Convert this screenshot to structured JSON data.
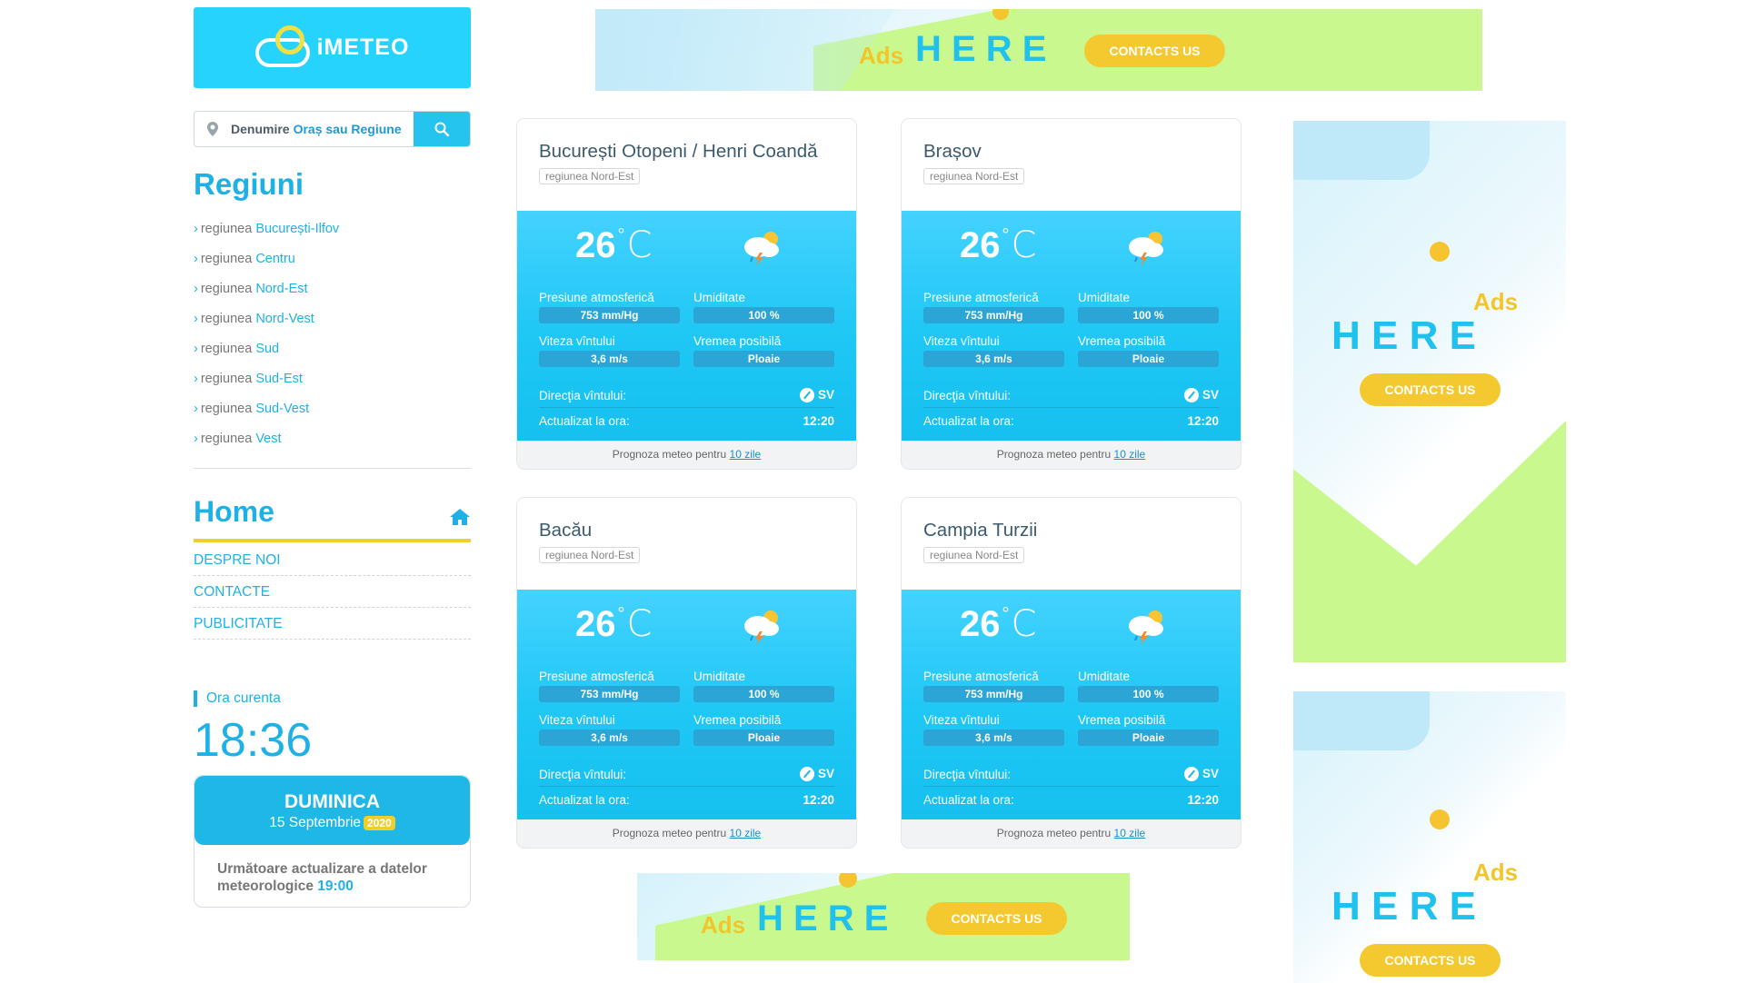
{
  "brand": {
    "logo_text": "iMETEO",
    "accent": "#25d3fd",
    "highlight": "#f1cf2b"
  },
  "search": {
    "placeholder_a": "Denumire",
    "placeholder_b": "Oraș sau Regiune"
  },
  "sidebar": {
    "regions_title": "Regiuni",
    "region_prefix": "regiunea",
    "regions": [
      "București-Ilfov",
      "Centru",
      "Nord-Est",
      "Nord-Vest",
      "Sud",
      "Sud-Est",
      "Sud-Vest",
      "Vest"
    ],
    "home_title": "Home",
    "menu": [
      "DESPRE NOI",
      "CONTACTE",
      "PUBLICITATE"
    ],
    "clock_label": "Ora curenta",
    "clock": "18:36",
    "day": "DUMINICA",
    "date": "15 Septembrie",
    "year": "2020",
    "next_update_text": "Următoare actualizare a datelor meteorologice",
    "next_update_time": "19:00"
  },
  "cards": [
    {
      "city": "București Otopeni / Henri Coandă",
      "region": "regiunea Nord-Est",
      "temp": "26",
      "unit": "C",
      "pressure_label": "Presiune atmosferică",
      "pressure": "753 mm/Hg",
      "humidity_label": "Umiditate",
      "humidity": "100 %",
      "wind_label": "Viteza vîntului",
      "wind": "3,6 m/s",
      "weather_label": "Vremea posibilă",
      "weather": "Ploaie",
      "dir_label": "Direcţia vîntului:",
      "dir": "SV",
      "updated_label": "Actualizat la ora:",
      "updated": "12:20",
      "forecast_text": "Prognoza meteo pentru",
      "forecast_link": "10 zile"
    },
    {
      "city": "Brașov",
      "region": "regiunea Nord-Est",
      "temp": "26",
      "unit": "C",
      "pressure_label": "Presiune atmosferică",
      "pressure": "753 mm/Hg",
      "humidity_label": "Umiditate",
      "humidity": "100 %",
      "wind_label": "Viteza vîntului",
      "wind": "3,6 m/s",
      "weather_label": "Vremea posibilă",
      "weather": "Ploaie",
      "dir_label": "Direcţia vîntului:",
      "dir": "SV",
      "updated_label": "Actualizat la ora:",
      "updated": "12:20",
      "forecast_text": "Prognoza meteo pentru",
      "forecast_link": "10 zile"
    },
    {
      "city": "Bacău",
      "region": "regiunea Nord-Est",
      "temp": "26",
      "unit": "C",
      "pressure_label": "Presiune atmosferică",
      "pressure": "753 mm/Hg",
      "humidity_label": "Umiditate",
      "humidity": "100 %",
      "wind_label": "Viteza vîntului",
      "wind": "3,6 m/s",
      "weather_label": "Vremea posibilă",
      "weather": "Ploaie",
      "dir_label": "Direcţia vîntului:",
      "dir": "SV",
      "updated_label": "Actualizat la ora:",
      "updated": "12:20",
      "forecast_text": "Prognoza meteo pentru",
      "forecast_link": "10 zile"
    },
    {
      "city": "Campia Turzii",
      "region": "regiunea Nord-Est",
      "temp": "26",
      "unit": "C",
      "pressure_label": "Presiune atmosferică",
      "pressure": "753 mm/Hg",
      "humidity_label": "Umiditate",
      "humidity": "100 %",
      "wind_label": "Viteza vîntului",
      "wind": "3,6 m/s",
      "weather_label": "Vremea posibilă",
      "weather": "Ploaie",
      "dir_label": "Direcţia vîntului:",
      "dir": "SV",
      "updated_label": "Actualizat la ora:",
      "updated": "12:20",
      "forecast_text": "Prognoza meteo pentru",
      "forecast_link": "10 zile"
    }
  ],
  "ads": {
    "ads_word": "Ads",
    "here_word": "H E R E",
    "cta": "CONTACTS US"
  }
}
